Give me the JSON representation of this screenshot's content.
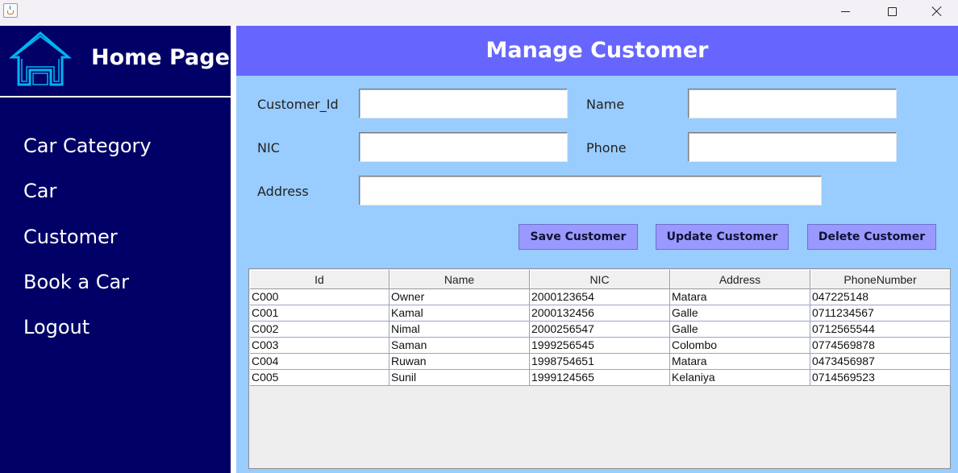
{
  "window": {
    "app_icon": "java-icon",
    "controls": {
      "minimize": "minimize-icon",
      "maximize": "maximize-icon",
      "close": "close-icon"
    }
  },
  "sidebar": {
    "home_icon": "home-icon",
    "title": "Home Page",
    "items": [
      {
        "label": "Car Category"
      },
      {
        "label": "Car"
      },
      {
        "label": "Customer"
      },
      {
        "label": "Book a Car"
      },
      {
        "label": "Logout"
      }
    ]
  },
  "main": {
    "title": "Manage Customer",
    "form": {
      "customer_id_label": "Customer_Id",
      "customer_id_value": "",
      "name_label": "Name",
      "name_value": "",
      "nic_label": "NIC",
      "nic_value": "",
      "phone_label": "Phone",
      "phone_value": "",
      "address_label": "Address",
      "address_value": ""
    },
    "buttons": {
      "save": "Save Customer",
      "update": "Update Customer",
      "delete": "Delete Customer"
    },
    "table": {
      "columns": [
        "Id",
        "Name",
        "NIC",
        "Address",
        "PhoneNumber"
      ],
      "rows": [
        [
          "C000",
          "Owner",
          "2000123654",
          "Matara",
          "047225148"
        ],
        [
          "C001",
          "Kamal",
          "2000132456",
          "Galle",
          "0711234567"
        ],
        [
          "C002",
          "Nimal",
          "2000256547",
          "Galle",
          "0712565544"
        ],
        [
          "C003",
          "Saman",
          "1999256545",
          "Colombo",
          "0774569878"
        ],
        [
          "C004",
          "Ruwan",
          "1998754651",
          "Matara",
          "0473456987"
        ],
        [
          "C005",
          "Sunil",
          "1999124565",
          "Kelaniya",
          "0714569523"
        ]
      ]
    }
  },
  "colors": {
    "sidebar_bg": "#000066",
    "header_bg": "#6666ff",
    "main_bg": "#99ccff",
    "button_bg": "#9999ff",
    "home_icon": "#00b4f0"
  }
}
